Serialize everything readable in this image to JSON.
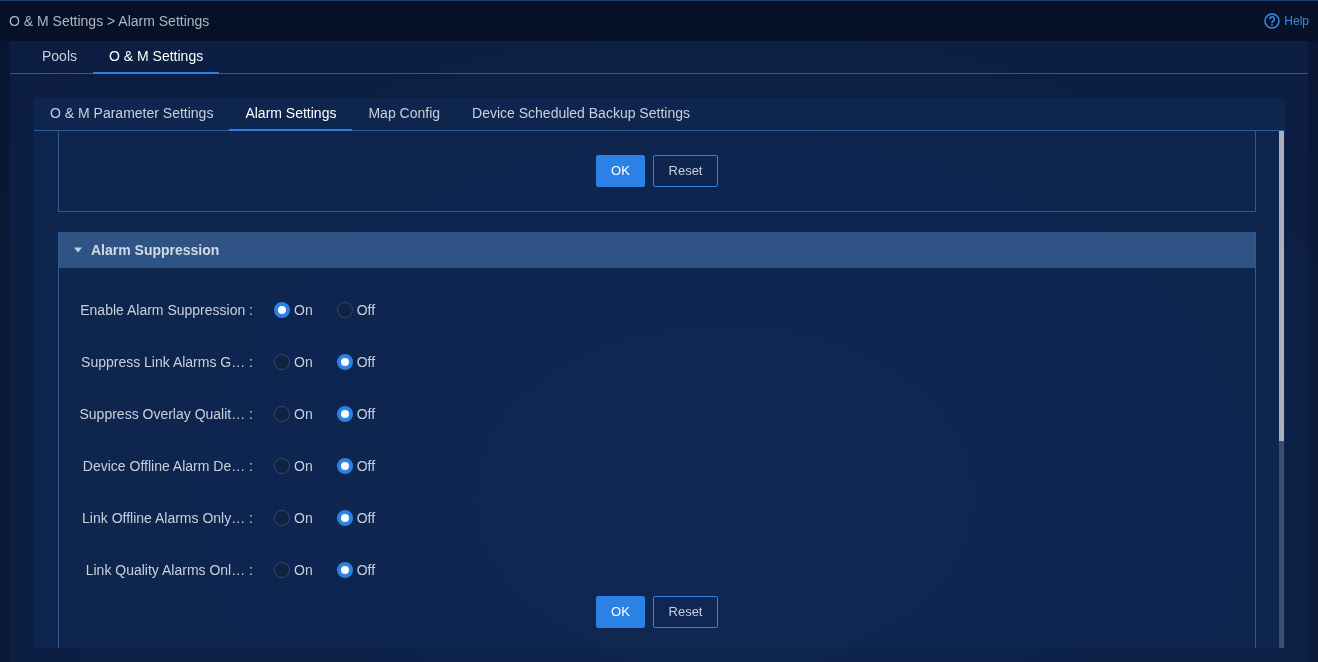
{
  "breadcrumb": "O & M Settings > Alarm Settings",
  "help": {
    "label": "Help"
  },
  "tabs": [
    {
      "label": "Pools",
      "selected": false
    },
    {
      "label": "O & M Settings",
      "selected": true
    }
  ],
  "sub_tabs": [
    {
      "label": "O & M Parameter Settings",
      "selected": false
    },
    {
      "label": "Alarm Settings",
      "selected": true
    },
    {
      "label": "Map Config",
      "selected": false
    },
    {
      "label": "Device Scheduled Backup Settings",
      "selected": false
    }
  ],
  "upper_section": {
    "buttons": [
      {
        "label": "OK",
        "kind": "primary"
      },
      {
        "label": "Reset",
        "kind": "outline"
      }
    ]
  },
  "alarm_suppression": {
    "title": "Alarm Suppression",
    "expanded": true,
    "rows": [
      {
        "label": "Enable Alarm Suppression :",
        "options": [
          {
            "label": "On",
            "selected": true
          },
          {
            "label": "Off",
            "selected": false
          }
        ]
      },
      {
        "label": "Suppress Link Alarms G… :",
        "options": [
          {
            "label": "On",
            "selected": false
          },
          {
            "label": "Off",
            "selected": true
          }
        ]
      },
      {
        "label": "Suppress Overlay Qualit… :",
        "options": [
          {
            "label": "On",
            "selected": false
          },
          {
            "label": "Off",
            "selected": true
          }
        ]
      },
      {
        "label": "Device Offline Alarm De… :",
        "options": [
          {
            "label": "On",
            "selected": false
          },
          {
            "label": "Off",
            "selected": true
          }
        ]
      },
      {
        "label": "Link Offline Alarms Only… :",
        "options": [
          {
            "label": "On",
            "selected": false
          },
          {
            "label": "Off",
            "selected": true
          }
        ]
      },
      {
        "label": "Link Quality Alarms Onl… :",
        "options": [
          {
            "label": "On",
            "selected": false
          },
          {
            "label": "Off",
            "selected": true
          }
        ]
      }
    ],
    "buttons": [
      {
        "label": "OK",
        "kind": "primary"
      },
      {
        "label": "Reset",
        "kind": "outline"
      }
    ]
  }
}
